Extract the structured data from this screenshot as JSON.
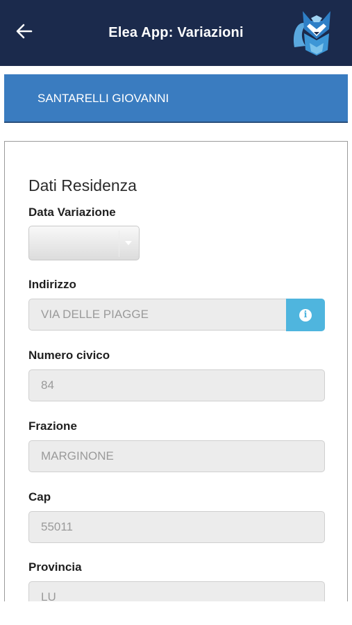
{
  "header": {
    "title": "Elea App: Variazioni",
    "back_icon": "arrow-left-icon",
    "logo_icon": "fox-logo-icon"
  },
  "banner": {
    "name": "SANTARELLI GIOVANNI"
  },
  "form": {
    "section_title": "Dati Residenza",
    "data_variazione": {
      "label": "Data Variazione",
      "value": ""
    },
    "indirizzo": {
      "label": "Indirizzo",
      "value": "VIA DELLE PIAGGE",
      "info_icon": "info-icon"
    },
    "numero_civico": {
      "label": "Numero civico",
      "value": "84"
    },
    "frazione": {
      "label": "Frazione",
      "value": "MARGINONE"
    },
    "cap": {
      "label": "Cap",
      "value": "55011"
    },
    "provincia": {
      "label": "Provincia",
      "value": "LU"
    }
  },
  "colors": {
    "topbar": "#1b2a4c",
    "banner": "#3a7cc0",
    "info_button": "#4fb5de",
    "input_bg": "#ececec"
  }
}
